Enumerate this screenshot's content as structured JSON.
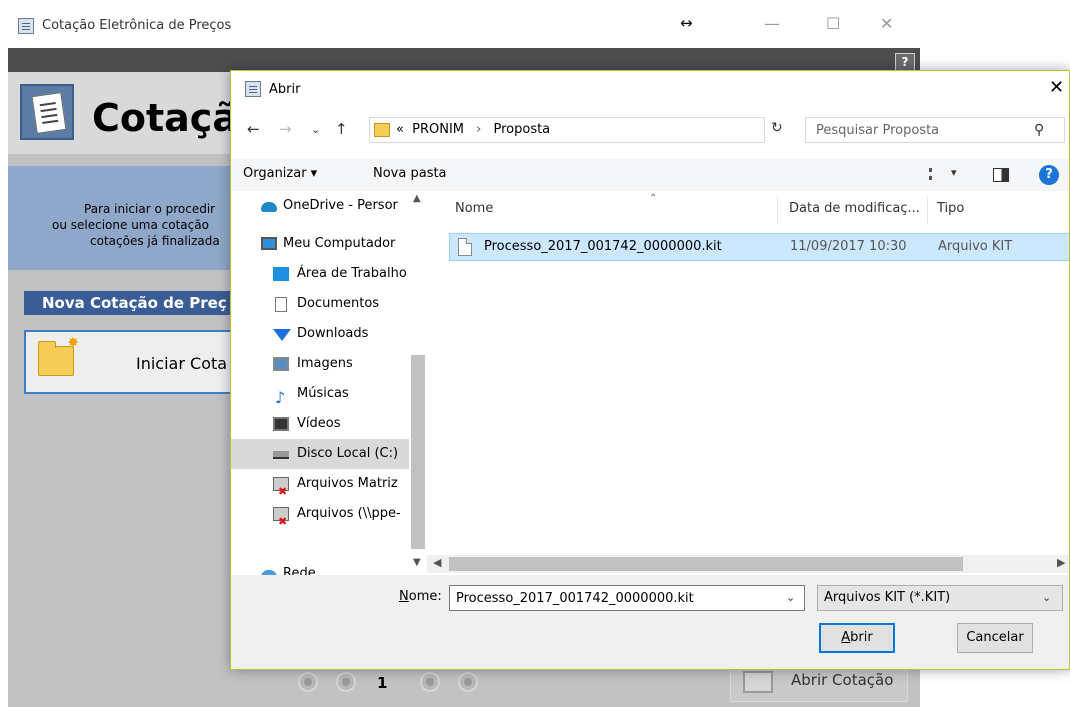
{
  "app": {
    "title": "Cotação Eletrônica de Preços",
    "resize_glyph": "↔",
    "header_title": "Cotação",
    "info_lines": [
      "Para iniciar o procedir",
      "ou selecione uma cotação",
      "cotações já finalizada"
    ],
    "section_title": "Nova Cotação de Preç",
    "start_button": "Iniciar Cota",
    "help_label": "?",
    "page_number": "1",
    "open_button": "Abrir Cotação"
  },
  "dialog": {
    "title": "Abrir",
    "close": "✕",
    "address": {
      "prefix": "«",
      "segments": [
        "PRONIM",
        "Proposta"
      ]
    },
    "search_placeholder": "Pesquisar Proposta",
    "toolbar": {
      "organize": "Organizar ▾",
      "new_folder": "Nova pasta"
    },
    "nav_items": [
      {
        "label": "OneDrive - Persor",
        "icon": "onedrive-icon"
      },
      {
        "label": "Meu Computador",
        "icon": "computer-icon"
      },
      {
        "label": "Área de Trabalho",
        "icon": "desktop-icon"
      },
      {
        "label": "Documentos",
        "icon": "document-icon"
      },
      {
        "label": "Downloads",
        "icon": "download-icon"
      },
      {
        "label": "Imagens",
        "icon": "images-icon"
      },
      {
        "label": "Músicas",
        "icon": "music-icon"
      },
      {
        "label": "Vídeos",
        "icon": "video-icon"
      },
      {
        "label": "Disco Local (C:)",
        "icon": "disk-icon"
      },
      {
        "label": "Arquivos Matriz",
        "icon": "network-drive-icon"
      },
      {
        "label": "Arquivos (\\\\ppe-",
        "icon": "network-drive-icon"
      },
      {
        "label": "Rede",
        "icon": "network-icon"
      }
    ],
    "columns": {
      "name": "Nome",
      "modified": "Data de modificaç...",
      "type": "Tipo"
    },
    "files": [
      {
        "name": "Processo_2017_001742_0000000.kit",
        "modified": "11/09/2017 10:30",
        "type": "Arquivo KIT"
      }
    ],
    "filename_label_underlined": "N",
    "filename_label_rest": "ome:",
    "filename_value": "Processo_2017_001742_0000000.kit",
    "filter": "Arquivos KIT (*.KIT)",
    "open_button_underlined": "A",
    "open_button_rest": "brir",
    "cancel_button": "Cancelar"
  }
}
